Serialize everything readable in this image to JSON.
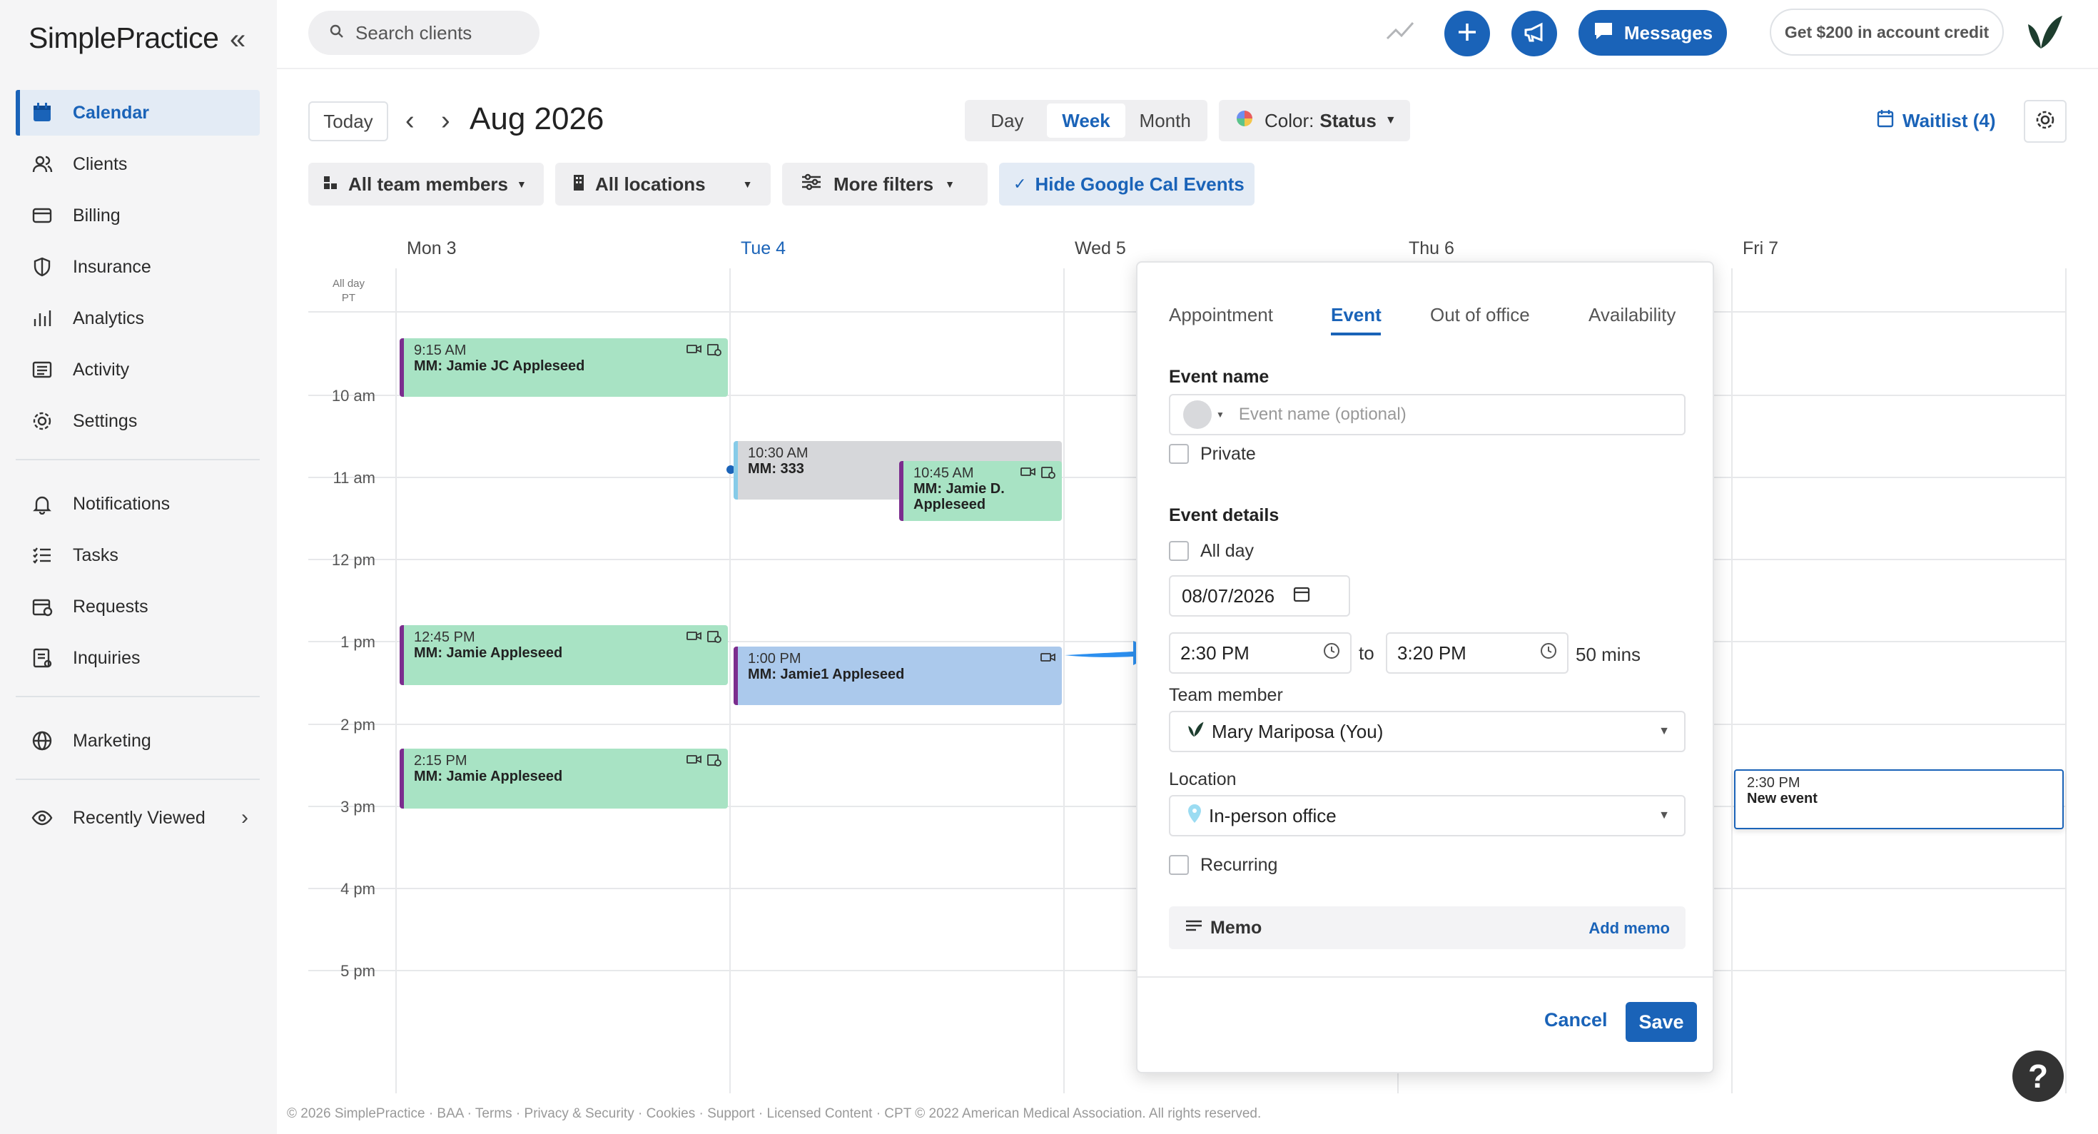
{
  "app": {
    "logo": "SimplePractice"
  },
  "sidebar": {
    "items": [
      {
        "label": "Calendar",
        "icon": "calendar-icon",
        "active": true
      },
      {
        "label": "Clients",
        "icon": "clients-icon"
      },
      {
        "label": "Billing",
        "icon": "billing-icon"
      },
      {
        "label": "Insurance",
        "icon": "shield-icon"
      },
      {
        "label": "Analytics",
        "icon": "analytics-icon"
      },
      {
        "label": "Activity",
        "icon": "activity-icon"
      },
      {
        "label": "Settings",
        "icon": "gear-icon"
      },
      {
        "label": "Notifications",
        "icon": "bell-icon"
      },
      {
        "label": "Tasks",
        "icon": "tasks-icon"
      },
      {
        "label": "Requests",
        "icon": "requests-icon"
      },
      {
        "label": "Inquiries",
        "icon": "inquiries-icon"
      },
      {
        "label": "Marketing",
        "icon": "globe-icon"
      },
      {
        "label": "Recently Viewed",
        "icon": "eye-icon"
      }
    ]
  },
  "topbar": {
    "search_placeholder": "Search clients",
    "messages_label": "Messages",
    "credit_label": "Get $200 in account credit"
  },
  "toolbar": {
    "today_label": "Today",
    "month_title": "Aug 2026",
    "views": [
      "Day",
      "Week",
      "Month"
    ],
    "active_view": "Week",
    "color_prefix": "Color:",
    "color_value": "Status",
    "waitlist_label": "Waitlist (4)",
    "filters": {
      "team": "All team members",
      "locations": "All locations",
      "more": "More filters",
      "google": "Hide Google Cal Events"
    }
  },
  "calendar": {
    "days": [
      "Mon 3",
      "Tue 4",
      "Wed 5",
      "Thu 6",
      "Fri 7"
    ],
    "today_index": 1,
    "allday_label": "All day",
    "tz_label": "PT",
    "hours": [
      "10 am",
      "11 am",
      "12 pm",
      "1 pm",
      "2 pm",
      "3 pm",
      "4 pm",
      "5 pm"
    ],
    "events": [
      {
        "time": "9:15 AM",
        "name": "MM: Jamie JC Appleseed"
      },
      {
        "time": "10:30 AM",
        "name": "MM: 333"
      },
      {
        "time": "10:45 AM",
        "name": "MM: Jamie D. Appleseed"
      },
      {
        "time": "12:45 PM",
        "name": "MM: Jamie Appleseed"
      },
      {
        "time": "1:00 PM",
        "name": "MM: Jamie1 Appleseed"
      },
      {
        "time": "2:15 PM",
        "name": "MM: Jamie Appleseed"
      },
      {
        "time": "2:30 PM",
        "name": "New event"
      }
    ]
  },
  "popover": {
    "tabs": [
      "Appointment",
      "Event",
      "Out of office",
      "Availability"
    ],
    "active_tab": "Event",
    "event_name_label": "Event name",
    "event_name_placeholder": "Event name (optional)",
    "private_label": "Private",
    "details_label": "Event details",
    "allday_label": "All day",
    "date_value": "08/07/2026",
    "start_time": "2:30 PM",
    "to_label": "to",
    "end_time": "3:20 PM",
    "duration": "50 mins",
    "team_member_label": "Team member",
    "team_member_value": "Mary Mariposa (You)",
    "location_label": "Location",
    "location_value": "In-person office",
    "recurring_label": "Recurring",
    "memo_label": "Memo",
    "add_memo_label": "Add memo",
    "cancel_label": "Cancel",
    "save_label": "Save"
  },
  "footer": "© 2026 SimplePractice · BAA · Terms · Privacy & Security · Cookies · Support · Licensed Content · CPT © 2022 American Medical Association. All rights reserved.",
  "colors": {
    "accent": "#1a63b8",
    "green_event": "#a8e3c4",
    "blue_event": "#abc9ec",
    "gray_event": "#d6d7da"
  }
}
